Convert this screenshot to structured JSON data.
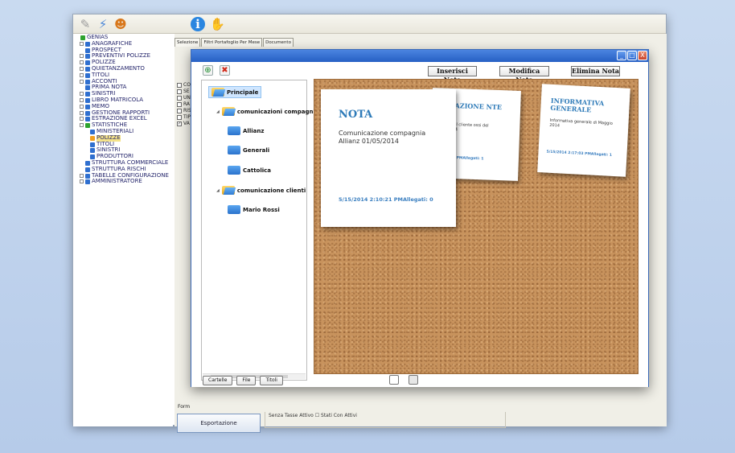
{
  "toolbar": {
    "icons": [
      "tool-icon",
      "connect-icon",
      "users-icon",
      "info-icon",
      "hand-icon"
    ]
  },
  "tree": {
    "items": [
      {
        "label": "GENIAS",
        "icon": "green",
        "indent": 0,
        "pm": false
      },
      {
        "label": "ANAGRAFICHE",
        "icon": "blue",
        "indent": 1,
        "pm": true
      },
      {
        "label": "PROSPECT",
        "icon": "blue",
        "indent": 1,
        "pm": false
      },
      {
        "label": "PREVENTIVI POLIZZE",
        "icon": "blue",
        "indent": 1,
        "pm": true
      },
      {
        "label": "POLIZZE",
        "icon": "blue",
        "indent": 1,
        "pm": true
      },
      {
        "label": "QUIETANZAMENTO",
        "icon": "blue",
        "indent": 1,
        "pm": true
      },
      {
        "label": "TITOLI",
        "icon": "blue",
        "indent": 1,
        "pm": true
      },
      {
        "label": "ACCONTI",
        "icon": "blue",
        "indent": 1,
        "pm": true
      },
      {
        "label": "PRIMA NOTA",
        "icon": "blue",
        "indent": 1,
        "pm": false
      },
      {
        "label": "SINISTRI",
        "icon": "blue",
        "indent": 1,
        "pm": true
      },
      {
        "label": "LIBRO MATRICOLA",
        "icon": "blue",
        "indent": 1,
        "pm": true
      },
      {
        "label": "MEMO",
        "icon": "blue",
        "indent": 1,
        "pm": true
      },
      {
        "label": "GESTIONE RAPPORTI",
        "icon": "blue",
        "indent": 1,
        "pm": true
      },
      {
        "label": "ESTRAZIONE EXCEL",
        "icon": "blue",
        "indent": 1,
        "pm": true
      },
      {
        "label": "STATISTICHE",
        "icon": "green",
        "indent": 1,
        "pm": true
      },
      {
        "label": "MINISTERIALI",
        "icon": "blue",
        "indent": 2,
        "pm": false
      },
      {
        "label": "POLIZZE",
        "icon": "orange",
        "indent": 2,
        "pm": false,
        "selected": true
      },
      {
        "label": "TITOLI",
        "icon": "blue",
        "indent": 2,
        "pm": false
      },
      {
        "label": "SINISTRI",
        "icon": "blue",
        "indent": 2,
        "pm": false
      },
      {
        "label": "PRODUTTORI",
        "icon": "blue",
        "indent": 2,
        "pm": false
      },
      {
        "label": "STRUTTURA COMMERCIALE",
        "icon": "blue",
        "indent": 1,
        "pm": false
      },
      {
        "label": "STRUTTURA RISCHI",
        "icon": "blue",
        "indent": 1,
        "pm": false
      },
      {
        "label": "TABELLE CONFIGURAZIONE",
        "icon": "blue",
        "indent": 1,
        "pm": true
      },
      {
        "label": "AMMINISTRATORE",
        "icon": "blue",
        "indent": 1,
        "pm": true
      }
    ]
  },
  "main": {
    "tabs": [
      "Selezione",
      "Filtri Portafoglio Per Mese",
      "Documento"
    ],
    "checklist": [
      {
        "label": "CO",
        "checked": false
      },
      {
        "label": "SE",
        "checked": false
      },
      {
        "label": "UN",
        "checked": false
      },
      {
        "label": "RA",
        "checked": false
      },
      {
        "label": "RIS",
        "checked": false
      },
      {
        "label": "TIP",
        "checked": false
      },
      {
        "label": "VA",
        "checked": true
      }
    ],
    "forma_label": "Form",
    "export_label": "Esportazione",
    "options_text": "Senza Tasse Attivo  ☐ Stati Con Attivi"
  },
  "window": {
    "buttons": {
      "insert": "Inserisci Nota",
      "edit": "Modifica Nota",
      "delete": "Elimina Nota"
    },
    "win_controls": [
      "_",
      "□",
      "X"
    ],
    "folders": [
      {
        "label": "Principale",
        "level": 0,
        "selected": true,
        "open": true
      },
      {
        "label": "comunicazioni compagnie",
        "level": 1,
        "open": true
      },
      {
        "label": "Allianz",
        "level": 2
      },
      {
        "label": "Generali",
        "level": 2
      },
      {
        "label": "Cattolica",
        "level": 2
      },
      {
        "label": "comunicazione clienti",
        "level": 1,
        "open": true
      },
      {
        "label": "Mario Rossi",
        "level": 2
      }
    ],
    "bottom_buttons": [
      "Cartelle",
      "File",
      "Titoli"
    ]
  },
  "notes": [
    {
      "title": "NOTA",
      "text": "Comunicazione compagnia Allianz 01/05/2014",
      "meta": "5/15/2014 2:10:21 PMAllegati: 0"
    },
    {
      "title": "UNICAZIONE NTE",
      "text": "cazione dal cliente ossi del 01/05/2014",
      "meta": "14 2:13:21 PMAllegati: 1"
    },
    {
      "title": "INFORMATIVA GENERALE",
      "text": "Informativa generale di Maggio 2014",
      "meta": "5/15/2014 2:17:03 PMAllegati: 1"
    }
  ],
  "colors": {
    "note_title": "#2d7ab8",
    "cork": "#c8935d",
    "titlebar": "#2660c4"
  }
}
